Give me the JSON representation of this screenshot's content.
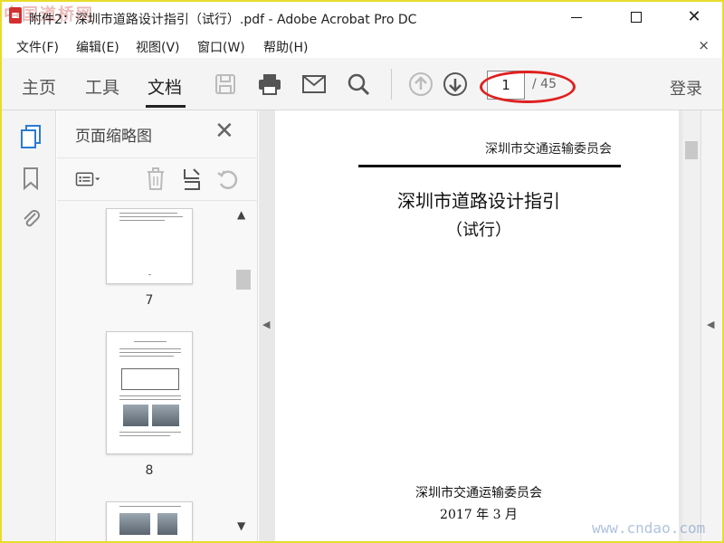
{
  "window": {
    "title": "附件2：深圳市道路设计指引（试行）.pdf - Adobe Acrobat Pro DC",
    "watermark_top": "中国道桥网",
    "watermark_bottom": "www.cndao.com"
  },
  "menu": {
    "items": [
      "文件(F)",
      "编辑(E)",
      "视图(V)",
      "窗口(W)",
      "帮助(H)"
    ],
    "close_glyph": "×"
  },
  "toolbar": {
    "tabs": [
      "主页",
      "工具",
      "文档"
    ],
    "active_tab": "文档",
    "page_current": "1",
    "page_total": "/ 45",
    "login_label": "登录",
    "highlight_color": "#e02020"
  },
  "thumbnails": {
    "title": "页面缩略图",
    "close_glyph": "✕",
    "pages": [
      {
        "number": "7"
      },
      {
        "number": "8"
      }
    ]
  },
  "document": {
    "header_org": "深圳市交通运输委员会",
    "title": "深圳市道路设计指引",
    "subtitle": "（试行）",
    "issuer": "深圳市交通运输委员会",
    "date": "2017 年 3 月"
  }
}
